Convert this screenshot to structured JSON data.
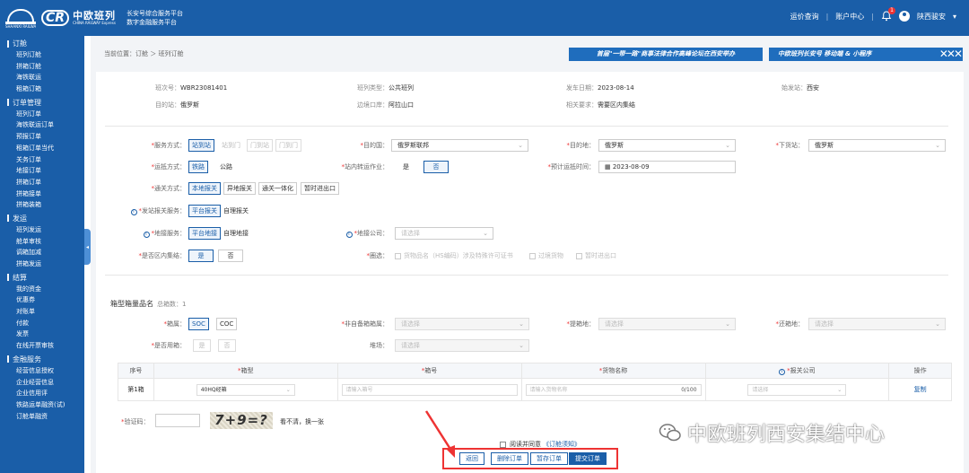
{
  "header": {
    "logo_emblem_text": "SHAANXI RAILWAY",
    "logo_cr": "CR",
    "logo_cn": "中欧班列",
    "logo_en": "CHINA RAILWAY Express",
    "subtitle_line1": "长安号综合服务平台",
    "subtitle_line2": "数字金融服务平台",
    "link_track": "运价查询",
    "link_account": "账户中心",
    "notification_count": "1",
    "user_name": "陕西骏安",
    "dropdown": "▾"
  },
  "sidebar": {
    "groups": [
      {
        "title": "订舱",
        "items": [
          "班列订舱",
          "拼箱订舱",
          "海铁联运",
          "租箱订箱"
        ]
      },
      {
        "title": "订单管理",
        "items": [
          "班列订单",
          "海铁联运订单",
          "预报订单",
          "租箱订单当代",
          "关务订单",
          "地接订单",
          "拼箱订单",
          "拼箱接单",
          "拼箱装箱"
        ]
      },
      {
        "title": "发运",
        "items": [
          "班列发运",
          "舱单审核",
          "调箱加减",
          "拼箱发运"
        ]
      },
      {
        "title": "结算",
        "items": [
          "我的资金",
          "优惠券",
          "对账单",
          "付款",
          "发票",
          "在线开票审核"
        ]
      },
      {
        "title": "金融服务",
        "items": [
          "经营信息授权",
          "企业经营信息",
          "企业信用评",
          "铁路运单融资(试)",
          "订舱单融资"
        ]
      }
    ],
    "collapse_glyph": "◂"
  },
  "breadcrumb": {
    "text": "当前位置：订舱 ＞ 班列订舱"
  },
  "banners": {
    "left": "首届\"一带一路\"商事法律合作高峰论坛在西安举办",
    "right": "中欧班列长安号 移动端 & 小程序",
    "right_deco": "✕✕✕"
  },
  "info": {
    "plan_no_label": "班次号：",
    "plan_no": "WBR23081401",
    "train_type_label": "班列类型：",
    "train_type": "公共班列",
    "depart_date_label": "发车日期：",
    "depart_date": "2023-08-14",
    "origin_label": "始发站：",
    "origin": "西安",
    "dest_label": "目的站：",
    "dest": "俄罗斯",
    "port_label": "边境口岸：",
    "port": "阿拉山口",
    "req_label": "相关要求：",
    "req": "需要区内集结"
  },
  "form": {
    "service_mode_label": "服务方式：",
    "service_mode_options": [
      "站到站",
      "站到门",
      "门到站",
      "门到门"
    ],
    "dest_country_label": "目的国：",
    "dest_country": "俄罗斯联邦",
    "dest_city_label": "目的地：",
    "dest_city": "俄罗斯",
    "unload_label": "下货站：",
    "unload": "俄罗斯",
    "transport_label": "运抵方式：",
    "transport_options": [
      "铁路",
      "公路"
    ],
    "transfer_label": "站内转运作业：",
    "transfer_options": [
      "是",
      "否"
    ],
    "arrive_time_label": "预计运抵时间：",
    "arrive_time": "2023-08-09",
    "customs_label": "通关方式：",
    "customs_options": [
      "本地报关",
      "异地报关",
      "通关一体化",
      "暂时进出口"
    ],
    "dep_customs_label": "发站报关服务：",
    "dep_customs_options": [
      "平台报关",
      "自理报关"
    ],
    "local_service_label": "地接服务：",
    "local_service_options": [
      "平台地接",
      "自理地接"
    ],
    "local_company_label": "地接公司：",
    "local_company_placeholder": "请选择",
    "zone_label": "是否区内集结：",
    "zone_options": [
      "是",
      "否"
    ],
    "zone_extra_label": "圈选：",
    "zone_checks": [
      "货物品名（HS编码）涉及特殊许可证书",
      "过境货物",
      "暂时进出口"
    ]
  },
  "container": {
    "section_title": "箱型箱量品名",
    "total_label": "总箱数：1",
    "box_type_label": "箱属：",
    "box_type_options": [
      "SOC",
      "COC"
    ],
    "own_type_label": "非自备箱箱属：",
    "own_type_placeholder": "请选择",
    "pick_label": "提箱地：",
    "pick_placeholder": "请选择",
    "return_label": "还箱地：",
    "return_placeholder": "请选择",
    "ship_label": "是否用箱：",
    "ship_options": [
      "是",
      "否"
    ],
    "yard_label": "堆场：",
    "yard_placeholder": "请选择",
    "table": {
      "headers": [
        "序号",
        "箱型",
        "箱号",
        "货物名称",
        "报关公司",
        "操作"
      ],
      "row": {
        "idx": "第1箱",
        "type": "40HQ经箱",
        "box_placeholder": "请输入箱号",
        "goods_placeholder": "请输入货物名称",
        "goods_count": "0/100",
        "company_placeholder": "请选择",
        "action": "复制"
      }
    }
  },
  "captcha": {
    "label": "验证码：",
    "image_text": "7+9=?",
    "refresh": "看不清，换一张"
  },
  "watermark": {
    "text": "中欧班列西安集结中心"
  },
  "footer": {
    "agree_text": "阅读并同意",
    "agree_link": "《订舱须知》",
    "buttons": [
      "返回",
      "删除订单",
      "暂存订单",
      "提交订单"
    ]
  }
}
